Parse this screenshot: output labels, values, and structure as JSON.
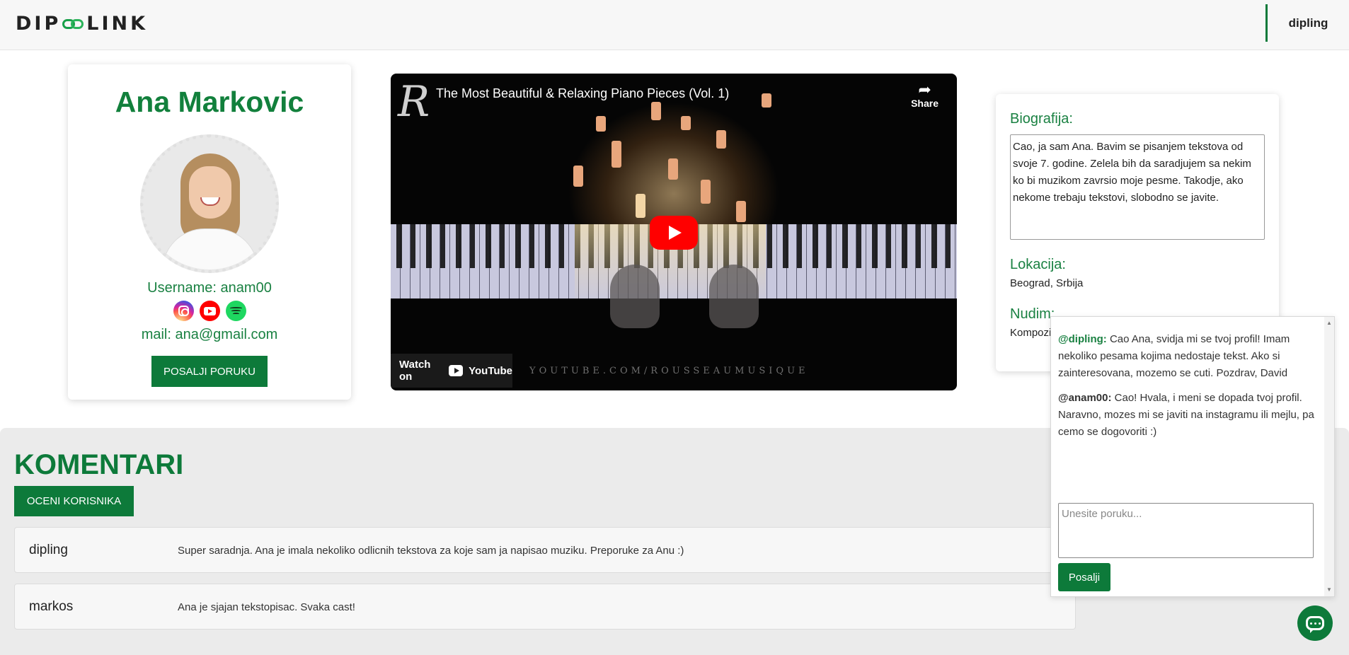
{
  "header": {
    "logo_text_left": "DIP",
    "logo_text_right": "LINK",
    "logo_icon": "chain-link-icon",
    "user": "dipling"
  },
  "profile": {
    "name": "Ana Markovic",
    "username": "Username: anam00",
    "email": "mail: ana@gmail.com",
    "social_icons": [
      "instagram-icon",
      "youtube-icon",
      "spotify-icon"
    ],
    "message_button": "POSALJI PORUKU"
  },
  "video": {
    "title": "The Most Beautiful & Relaxing Piano Pieces (Vol. 1)",
    "share_label": "Share",
    "watch_on": "Watch on",
    "youtube_label": "YouTube",
    "watermark": "YOUTUBE.COM/ROUSSEAUMUSIQUE"
  },
  "info": {
    "bio_label": "Biografija:",
    "bio_text": "Cao, ja sam Ana. Bavim se pisanjem tekstova od svoje 7. godine. Zelela bih da saradjujem sa nekim ko bi muzikom zavrsio moje pesme. Takodje, ako nekome trebaju tekstovi, slobodno se javite.",
    "location_label": "Lokacija:",
    "location_value": "Beograd, Srbija",
    "offer_label": "Nudim:",
    "offer_value": "Kompozicije"
  },
  "comments": {
    "title": "KOMENTARI",
    "rate_button": "OCENI KORISNIKA",
    "items": [
      {
        "user": "dipling",
        "text": "Super saradnja. Ana je imala nekoliko odlicnih tekstova za koje sam ja napisao muziku. Preporuke za Anu :)"
      },
      {
        "user": "markos",
        "text": "Ana je sjajan tekstopisac. Svaka cast!"
      }
    ]
  },
  "chat": {
    "messages": [
      {
        "author": "@dipling:",
        "text": " Cao Ana, svidja mi se tvoj profil! Imam nekoliko pesama kojima nedostaje tekst. Ako si zainteresovana, mozemo se cuti. Pozdrav, David"
      },
      {
        "author": "@anam00:",
        "text": " Cao! Hvala, i meni se dopada tvoj profil. Naravno, mozes mi se javiti na instagramu ili mejlu, pa cemo se dogovoriti :)"
      }
    ],
    "input_placeholder": "Unesite poruku...",
    "send_button": "Posalji"
  },
  "colors": {
    "brand_green": "#0d7a3a",
    "text_green": "#1a8142"
  }
}
